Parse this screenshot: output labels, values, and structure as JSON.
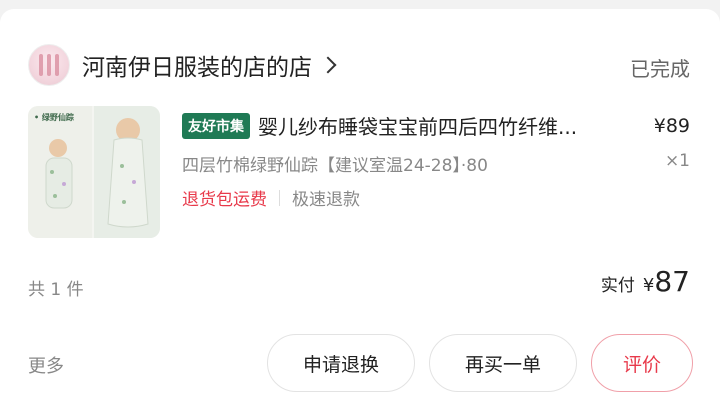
{
  "order": {
    "store_name": "河南伊日服装的店的店",
    "status": "已完成",
    "item": {
      "thumb_tag": "• 绿野仙踪",
      "badge": "友好市集",
      "title": "婴儿纱布睡袋宝宝前四后四竹纤维...",
      "price": "¥89",
      "spec": "四层竹棉绿野仙踪【建议室温24-28】·80",
      "quantity": "×1",
      "service_return": "退货包运费",
      "service_refund": "极速退款"
    },
    "count_text": "共 1 件",
    "paid_label": "实付",
    "paid_currency": "¥",
    "paid_amount": "87",
    "more": "更多",
    "buttons": {
      "refund": "申请退换",
      "rebuy": "再买一单",
      "review": "评价"
    }
  },
  "colors": {
    "accent_red": "#e8394a",
    "badge_green": "#1f7a55"
  }
}
